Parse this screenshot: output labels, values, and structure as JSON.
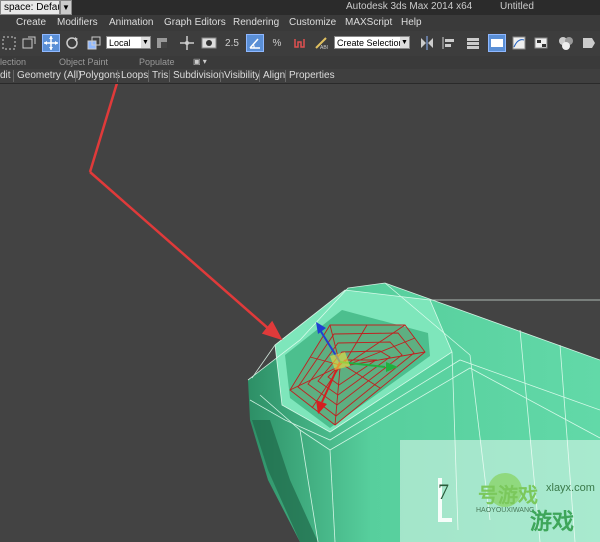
{
  "titlebar": {
    "workspace": "space: Default",
    "app_title": "Autodesk 3ds Max  2014 x64",
    "doc_title": "Untitled"
  },
  "menu": [
    "Create",
    "Modifiers",
    "Animation",
    "Graph Editors",
    "Rendering",
    "Customize",
    "MAXScript",
    "Help"
  ],
  "toolbar": {
    "coord_system": "Local",
    "snap_label": "2.5",
    "percent_label": "%",
    "selection_set_placeholder": "Create Selection Se"
  },
  "ribbon": {
    "tabs": [
      "lection",
      "Object Paint",
      "Populate"
    ],
    "items": [
      "dit",
      "Geometry (All)",
      "Polygons",
      "Loops",
      "Tris",
      "Subdivision",
      "Visibility",
      "Align",
      "Properties"
    ]
  },
  "watermark": {
    "number": "7",
    "site": "xlayx.com",
    "brand_cn": "号游戏",
    "brand_pinyin": "HAOYOUXIWANG",
    "brand_cn2": "游戏"
  },
  "colors": {
    "viewport_bg": "#434343",
    "object": "#5fd6a5",
    "selection": "#c02020",
    "arrow": "#e03a3a"
  }
}
